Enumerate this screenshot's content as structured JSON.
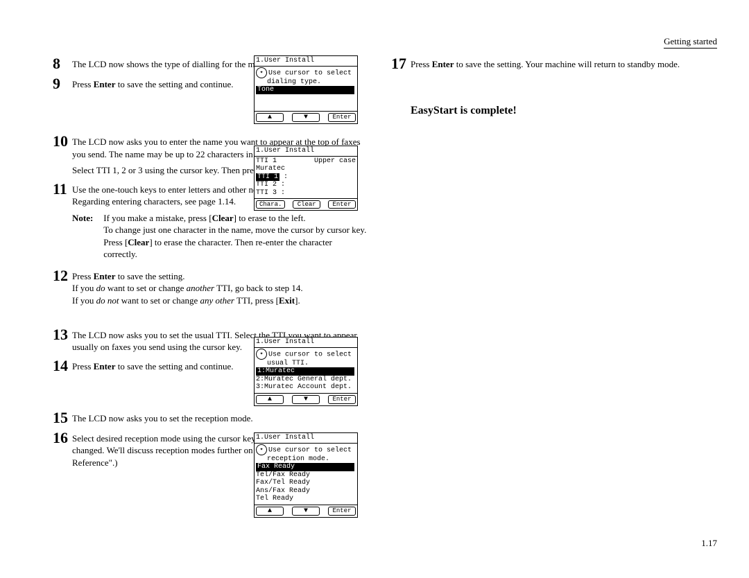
{
  "header": "Getting started",
  "page_number": "1.17",
  "complete_text": "EasyStart is complete!",
  "steps": {
    "s8": "The <span class='smallcaps'>LCD</span> now shows the type of dialling for the machine.",
    "s9": "Press <b>Enter</b> to save the setting and continue.",
    "s10a": "The <span class='smallcaps'>LCD</span> now asks you to enter the name you want to appear at the top of faxes you send. The name may be up to 22 characters in length.",
    "s10b": "Select TTI 1, 2 or 3 using the cursor key. Then press <b>Enter</b>.",
    "s11": "Use the one-touch keys to enter letters and other non-numeric characters. Regarding entering characters, see page 1.14.",
    "note_label": "Note:",
    "note_text": "If you make a mistake, press [<b>Clear</b>] to erase to the left.<br>To change just one character in the name, move the cursor by cursor key. Press [<b>Clear</b>] to erase the character. Then re-enter the character correctly.",
    "s12": "Press <b>Enter</b> to save the setting.<br>If you <i>do</i> want to set or change <i>another</i> TTI, go back to step 14.<br>If you <i>do not</i> want to set or change <i>any other</i> TTI, press [<b>Exit</b>].",
    "s13": "The <span class='smallcaps'>LCD</span> now asks you to set the usual TTI. Select the TTI you want to appear usually on faxes you send using the cursor key.",
    "s14": "Press <b>Enter</b> to save the setting and continue.",
    "s15": "The <span class='smallcaps'>LCD</span> now asks you to set the reception mode.",
    "s16": "Select desired reception mode using the cursor key. (This setting can always be changed. We'll discuss reception modes further on pages 1.12-1.13 in \"Fax Reference\".)",
    "s17": "Press <b>Enter</b> to save the setting. Your machine will return to standby mode."
  },
  "lcd1": {
    "title": "1.User Install",
    "hint1": "Use cursor to select",
    "hint2": "dialing type.",
    "sel": "Tone",
    "btn_enter": "Enter"
  },
  "lcd2": {
    "title": "1.User Install",
    "row1l": "TTI 1",
    "row1r": "Upper case",
    "row2": "Muratec",
    "sel": "TTI 1",
    "row4": "TTI 2      :",
    "row5": "TTI 3      :",
    "b1": "Chara.",
    "b2": "Clear",
    "b3": "Enter"
  },
  "lcd3": {
    "title": "1.User Install",
    "hint1": "Use cursor to select",
    "hint2": "usual TTI.",
    "sel": "1:Muratec",
    "row2": "2:Muratec General dept.",
    "row3": "3:Muratec Account dept.",
    "btn_enter": "Enter"
  },
  "lcd4": {
    "title": "1.User Install",
    "hint1": "Use cursor to select",
    "hint2": "reception mode.",
    "sel": "Fax Ready",
    "r2": "Tel/Fax Ready",
    "r3": "Fax/Tel Ready",
    "r4": "Ans/Fax Ready",
    "r5": "Tel Ready",
    "btn_enter": "Enter"
  }
}
